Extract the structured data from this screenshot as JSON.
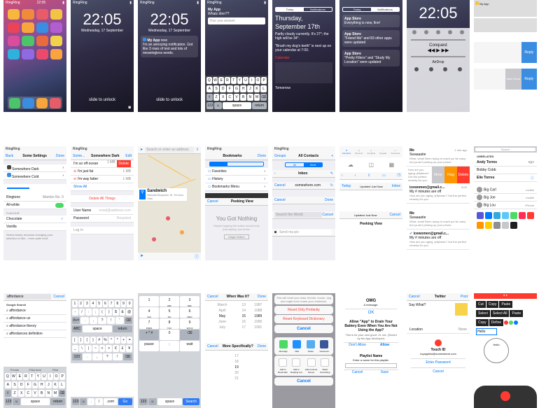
{
  "status": {
    "carrier": "RingRing",
    "time": "22:05"
  },
  "lock": {
    "time": "22:05",
    "date": "Wednesday, 17 September",
    "slide": "slide to unlock"
  },
  "notif": {
    "app": "My App",
    "when": "now",
    "text": "I'm an annoying notification. Got like 3 rows of text and lots of meaningless words."
  },
  "reply": {
    "app": "My App",
    "question": "Whatz dinn??",
    "placeholder": "Your you answer"
  },
  "today": {
    "tab1": "Today",
    "tab2": "Notifications",
    "day": "Thursday,",
    "date": "September 17th",
    "weather": "Partly cloudy currently. It's 27°; the high will be 34°.",
    "commute": "\"Brush my dog's teeth\" is next up on your calendar at 7:00.",
    "calendar": "Calendar",
    "tomorrow": "Tomorrow"
  },
  "notifs": {
    "tab1": "Today",
    "tab2": "Notifications",
    "store": "App Store",
    "items": [
      "Everything is new, fine!",
      "\"Friend Me\" and 83 other apps were updated",
      "\"Pretty Filters\" and \"Study My Location\" were updated"
    ]
  },
  "cc": {
    "track": "Conquest",
    "airdrop": "AirDrop"
  },
  "replies": {
    "reply": "Reply",
    "mark": "Mark Read"
  },
  "settings": {
    "back": "Back",
    "title": "Some Settings",
    "done": "Done",
    "items": [
      "Somewhere Dark",
      "Somewhere Cold"
    ],
    "ringtone": "Ringtone",
    "ringtone_val": "Mambo No. 5",
    "allwhite": "All-white",
    "flavour": "Flavour",
    "flavours": [
      "Chocolate",
      "Vanilla"
    ],
    "footer": "Select wisely, because changing your selection is like... hmm quite hard."
  },
  "del": {
    "back": "Some...",
    "title": "Somewhere Dark",
    "edit": "Edit",
    "rows": [
      {
        "t": "I'm so off-ocean",
        "v": "1 MB"
      },
      {
        "t": "I'm just fat",
        "v": "1 MB"
      },
      {
        "t": "I'm way fatter",
        "v": "1 MB"
      }
    ],
    "delete": "Delete",
    "showall": "Show All",
    "deleteall": "Delete All Things",
    "user": "User Name",
    "user_ph": "email@address.com",
    "password": "Password",
    "password_ph": "Required",
    "login": "Log In"
  },
  "maps": {
    "search": "Search or enter an address",
    "place": "Sandwich",
    "addr": "Nahalat Binyamin St, Tel Aviv-Yafo"
  },
  "bookmarks": {
    "title": "Bookmarks",
    "done": "Done",
    "items": [
      "Favorites",
      "History",
      "Bookmarks Menu"
    ],
    "cancel": "Cancel",
    "peek": "Peeking View",
    "empty": "You Got Nothing",
    "empty_sub": "Maybe tapping the button would help just saying, you know.",
    "empty_btn": "Magic Button"
  },
  "mail": {
    "groups": "Groups",
    "title": "All Contacts",
    "add": "+",
    "seg1": "All",
    "seg2": "Sent",
    "inbox": "Inbox",
    "cancel": "Cancel",
    "done": "Done",
    "url": "somewhere.com",
    "search": "Search the World",
    "send": "Send ma pix"
  },
  "icloud": {
    "today": "Today",
    "updated": "Updated Just Now",
    "inbox": "Inbox",
    "cancel": "Cancel",
    "peek": "Peeking View",
    "icons": [
      "Favorites",
      "Recents",
      "Contacts",
      "Keypad",
      "Voicemail"
    ]
  },
  "messages": {
    "me": "Me",
    "sender": "icewomen@gmail.c...",
    "subject": "Swaaaatie",
    "preview": "What, what! Been trying to reach ya his crazy but ya ain't picking up your phone.",
    "times": [
      "1 min ago",
      "8:00"
    ],
    "more": "More",
    "flag": "Flag",
    "delete": "Delete",
    "sub2": "My # minutes are off",
    "preview2": "How are you aging, jellybean? Got the perfect remedy for you."
  },
  "contacts": {
    "search": "Search",
    "title": "Unrelated",
    "people": [
      {
        "n": "Andy Torres",
        "t": "ago"
      },
      {
        "n": "Bobby Cobb",
        "t": ""
      },
      {
        "n": "Elie Torres",
        "t": ""
      }
    ],
    "chat": [
      {
        "n": "Big Carl",
        "t": "mobile"
      },
      {
        "n": "Big Joe",
        "t": "mobile"
      },
      {
        "n": "Big Lou",
        "t": "iPhone"
      }
    ]
  },
  "google": {
    "query": "affordance",
    "cancel": "Cancel",
    "header": "Google Search",
    "results": [
      "affordance",
      "affordance ux",
      "affordance theory",
      "affordances definition"
    ],
    "suggest": [
      "Private",
      "Pillai beat",
      "Fillai"
    ]
  },
  "keyboard": {
    "space": "space",
    "return": "return",
    "abc": "ABC",
    "go": "Go",
    "com": ".com",
    "search": "Search"
  },
  "numpad": {
    "keys": [
      [
        "1",
        "2",
        "3"
      ],
      [
        "4",
        "5",
        "6"
      ],
      [
        "7",
        "8",
        "9"
      ],
      [
        "+ * #",
        "0",
        "⌫"
      ]
    ],
    "letters": [
      [
        "",
        "ABC",
        "DEF"
      ],
      [
        "GHI",
        "JKL",
        "MNO"
      ],
      [
        "PQRS",
        "TUV",
        "WXYZ"
      ]
    ],
    "pause": "pause",
    "wait": "wait"
  },
  "picker": {
    "cancel": "Cancel",
    "title": "When Was It?",
    "done": "Done",
    "months": [
      "March",
      "April",
      "May",
      "June",
      "July"
    ],
    "days": [
      "13",
      "14",
      "15",
      "16",
      "17"
    ],
    "years": [
      "1987",
      "1988",
      "1989",
      "1990",
      "1991"
    ],
    "title2": "More Specifically?",
    "nums": [
      "17",
      "18",
      "19",
      "20",
      "21"
    ]
  },
  "share": {
    "profanity": "Reset Only Profanity",
    "keyboard": "Reset Keyboard Dictionary",
    "cancel": "Cancel",
    "apps": [
      "Message",
      "Mail",
      "Twitter",
      "Facebook"
    ],
    "actions": [
      "Add to Bookmark",
      "Add to Reading List",
      "Add to Home Screen",
      "Read Something"
    ],
    "cancel2": "Cancel",
    "info": "This will reset your data, friends, house, dog and might even erase your existence."
  },
  "alerts": {
    "title": "OMG",
    "msg": "A message.",
    "ok": "OK",
    "drain": "Allow \"App\" to Drain Your Battery Even When You Are Not Using the App?",
    "drain_sub": "This is for your own good. Or not. (Stored by the App developer)",
    "dont": "Don't Allow",
    "allow": "Allow",
    "playlist": "Playlist Name",
    "playlist_sub": "Enter a name for this playlist.",
    "cancel": "Cancel",
    "save": "Save"
  },
  "twitter": {
    "cancel": "Cancel",
    "title": "Twitter",
    "post": "Post",
    "text": "Say What?",
    "location": "Location",
    "none": "None",
    "touch": "Touch ID",
    "touch_sub": "myapplied@somewhere.com",
    "pwd": "Enter Password",
    "cancel2": "Cancel"
  },
  "edit": {
    "menu1": [
      "Cut",
      "Copy",
      "Paste"
    ],
    "menu2": [
      "Select",
      "Select All",
      "Paste"
    ],
    "menu3": [
      "Copy",
      "Define"
    ],
    "hello": "Hello",
    "hint": "Hello"
  }
}
